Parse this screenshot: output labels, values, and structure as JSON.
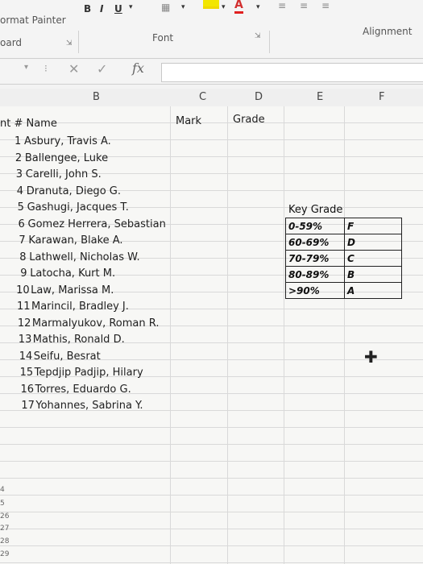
{
  "ribbon": {
    "format_painter": "ormat Painter",
    "clipboard": "oard",
    "font_group": "Font",
    "alignment_group": "Alignment",
    "bold": "B",
    "italic": "I",
    "underline": "U",
    "font_color_letter": "A"
  },
  "formula_bar": {
    "fx": "fx"
  },
  "columns": [
    "B",
    "C",
    "D",
    "E",
    "F"
  ],
  "headers": {
    "number_name": "nt # Name",
    "mark": "Mark",
    "grade": "Grade"
  },
  "students": [
    {
      "num": "1",
      "name": "Asbury, Travis A."
    },
    {
      "num": "2",
      "name": "Ballengee, Luke"
    },
    {
      "num": "3",
      "name": "Carelli, John S."
    },
    {
      "num": "4",
      "name": "Dranuta, Diego G."
    },
    {
      "num": "5",
      "name": "Gashugi, Jacques T."
    },
    {
      "num": "6",
      "name": "Gomez Herrera, Sebastian"
    },
    {
      "num": "7",
      "name": "Karawan, Blake A."
    },
    {
      "num": "8",
      "name": "Lathwell, Nicholas W."
    },
    {
      "num": "9",
      "name": "Latocha, Kurt M."
    },
    {
      "num": "10",
      "name": "Law, Marissa M."
    },
    {
      "num": "11",
      "name": "Marincil, Bradley J."
    },
    {
      "num": "12",
      "name": "Marmalyukov, Roman R."
    },
    {
      "num": "13",
      "name": "Mathis, Ronald D."
    },
    {
      "num": "14",
      "name": "Seifu, Besrat"
    },
    {
      "num": "15",
      "name": "Tepdjip Padjip, Hilary"
    },
    {
      "num": "16",
      "name": "Torres, Eduardo G."
    },
    {
      "num": "17",
      "name": "Yohannes, Sabrina Y."
    }
  ],
  "key": {
    "title": "Key Grade",
    "rows": [
      {
        "range": "0-59%",
        "grade": "F"
      },
      {
        "range": "60-69%",
        "grade": "D"
      },
      {
        "range": "70-79%",
        "grade": "C"
      },
      {
        "range": "80-89%",
        "grade": "B"
      },
      {
        "range": ">90%",
        "grade": "A"
      }
    ]
  },
  "row_numbers": [
    "4",
    "5",
    "26",
    "27",
    "28",
    "29"
  ]
}
